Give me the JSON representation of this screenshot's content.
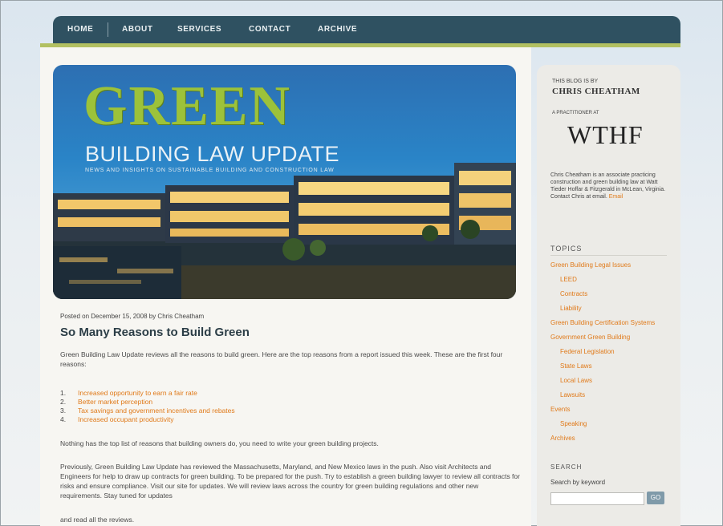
{
  "nav": {
    "items": [
      "HOME",
      "ABOUT",
      "SERVICES",
      "CONTACT",
      "ARCHIVE"
    ]
  },
  "banner": {
    "title": "GREEN",
    "subtitle": "BUILDING LAW UPDATE",
    "tagline": "NEWS AND INSIGHTS ON SUSTAINABLE BUILDING AND CONSTRUCTION LAW"
  },
  "post": {
    "meta": "Posted on December 15, 2008 by Chris Cheatham",
    "title": "So Many Reasons to Build Green",
    "intro": "Green Building Law Update reviews all the reasons to build green. Here are the top reasons from a report issued this week. These are the first four reasons:",
    "list": [
      {
        "n": "1.",
        "text": "Increased opportunity to earn a fair rate"
      },
      {
        "n": "2.",
        "text": "Better market perception"
      },
      {
        "n": "3.",
        "text": "Tax savings and government incentives and rebates"
      },
      {
        "n": "4.",
        "text": "Increased occupant productivity"
      }
    ],
    "para2": "Nothing has the top list of reasons that building owners do, you need to write your green building projects.",
    "para3": "Previously, Green Building Law Update has reviewed the Massachusetts, Maryland, and New Mexico laws in the push. Also visit Architects and Engineers for help to draw up contracts for green building. To be prepared for the",
    "para4": "push. Try to establish a green building lawyer to review all contracts for risks and ensure compliance. Visit our site for updates. We will review laws across the country for green building regulations and other new requirements. Stay tuned for updates",
    "para5": "and read all the reviews."
  },
  "sidebar": {
    "by_line": "THIS BLOG IS BY",
    "author": "CHRIS CHEATHAM",
    "firm_line": "A PRACTITIONER AT",
    "logo": "WTHF",
    "bio": "Chris Cheatham is an associate practicing construction and green building law at Watt Tieder Hoffar & Fitzgerald in McLean, Virginia. Contact Chris at email.",
    "bio_link": "Email",
    "topics_heading": "TOPICS",
    "topics": [
      {
        "label": "Green Building Legal Issues",
        "indent": false
      },
      {
        "label": "LEED",
        "indent": true
      },
      {
        "label": "Contracts",
        "indent": true
      },
      {
        "label": "Liability",
        "indent": true
      },
      {
        "label": "Green Building Certification Systems",
        "indent": false
      },
      {
        "label": "Government Green Building",
        "indent": false
      },
      {
        "label": "Federal Legislation",
        "indent": true
      },
      {
        "label": "State Laws",
        "indent": true
      },
      {
        "label": "Local Laws",
        "indent": true
      },
      {
        "label": "Lawsuits",
        "indent": true
      },
      {
        "label": "Events",
        "indent": false
      },
      {
        "label": "Speaking",
        "indent": true
      },
      {
        "label": "Archives",
        "indent": false
      }
    ],
    "search_heading": "SEARCH",
    "search_label": "Search by keyword",
    "search_button": "GO"
  }
}
